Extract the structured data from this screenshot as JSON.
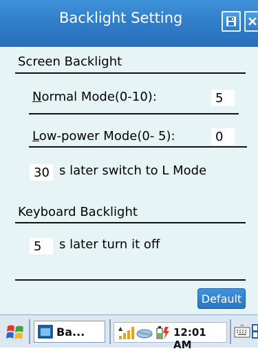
{
  "window": {
    "title": "Backlight Setting"
  },
  "screen_backlight": {
    "section_label": "Screen Backlight",
    "normal_mode_prefix": "N",
    "normal_mode_rest": "ormal Mode(0-10):",
    "normal_mode_value": "5",
    "low_power_prefix": "L",
    "low_power_rest": "ow-power Mode(0- 5):",
    "low_power_value": "0",
    "delay_value": "30",
    "delay_label": "s later switch to L Mode"
  },
  "keyboard_backlight": {
    "section_label": "Keyboard Backlight",
    "delay_value": "5",
    "delay_label": "s later turn it off"
  },
  "buttons": {
    "default_label": "Default"
  },
  "taskbar": {
    "task_label": "Ba...",
    "clock": "12:01 AM"
  }
}
